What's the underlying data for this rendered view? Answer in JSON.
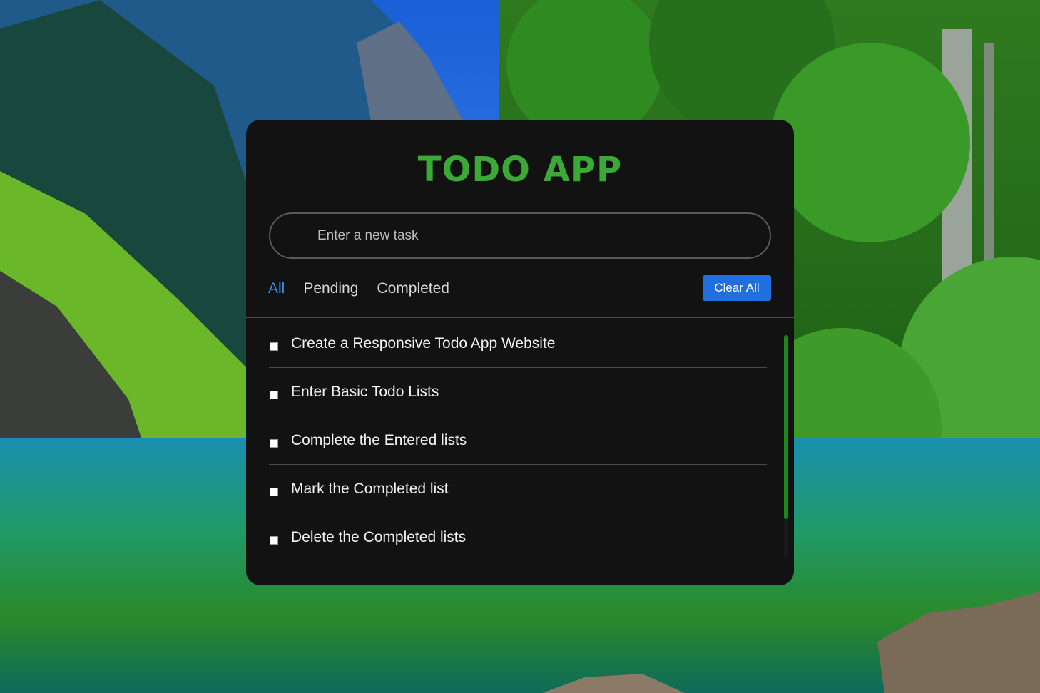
{
  "app": {
    "title": "TODO APP"
  },
  "input": {
    "placeholder": "Enter a new task",
    "value": ""
  },
  "filters": [
    {
      "label": "All",
      "active": true
    },
    {
      "label": "Pending",
      "active": false
    },
    {
      "label": "Completed",
      "active": false
    }
  ],
  "actions": {
    "clear_all_label": "Clear All"
  },
  "tasks": [
    {
      "text": "Create a Responsive Todo App Website",
      "completed": false
    },
    {
      "text": "Enter Basic Todo Lists",
      "completed": false
    },
    {
      "text": "Complete the Entered lists",
      "completed": false
    },
    {
      "text": "Mark the Completed list",
      "completed": false
    },
    {
      "text": "Delete the Completed lists",
      "completed": false
    }
  ],
  "colors": {
    "title": "#3aa935",
    "active_filter": "#3b8ff0",
    "button": "#1f6fde",
    "card": "#121212",
    "scroll_thumb": "#1a8a1a"
  },
  "icons": {
    "background": "mountain-lake-landscape"
  }
}
